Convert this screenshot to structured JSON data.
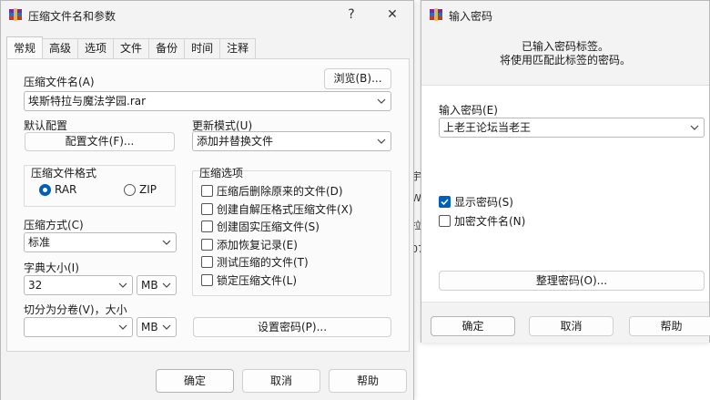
{
  "main_dialog": {
    "title": "压缩文件名和参数",
    "help_glyph": "?",
    "close_glyph": "✕",
    "tabs": [
      "常规",
      "高级",
      "选项",
      "文件",
      "备份",
      "时间",
      "注释"
    ],
    "archive_name_label": "压缩文件名(A)",
    "browse_button": "浏览(B)...",
    "archive_name_value": "埃斯特拉与魔法学园.rar",
    "default_profile_label": "默认配置",
    "profiles_button": "配置文件(F)...",
    "update_mode_label": "更新模式(U)",
    "update_mode_value": "添加并替换文件",
    "format_group_label": "压缩文件格式",
    "format_rar": "RAR",
    "format_zip": "ZIP",
    "format_selected": "RAR",
    "options_group_label": "压缩选项",
    "options": [
      {
        "label": "压缩后删除原来的文件(D)",
        "checked": false
      },
      {
        "label": "创建自解压格式压缩文件(X)",
        "checked": false
      },
      {
        "label": "创建固实压缩文件(S)",
        "checked": false
      },
      {
        "label": "添加恢复记录(E)",
        "checked": false
      },
      {
        "label": "测试压缩的文件(T)",
        "checked": false
      },
      {
        "label": "锁定压缩文件(L)",
        "checked": false
      }
    ],
    "method_label": "压缩方式(C)",
    "method_value": "标准",
    "dict_label": "字典大小(I)",
    "dict_value": "32",
    "dict_unit": "MB",
    "split_label": "切分为分卷(V)，大小",
    "split_value": "",
    "split_unit": "MB",
    "set_password_button": "设置密码(P)...",
    "ok_button": "确定",
    "cancel_button": "取消",
    "help_button": "帮助"
  },
  "password_dialog": {
    "title": "输入密码",
    "info_line1": "已输入密码标签。",
    "info_line2": "将使用匹配此标签的密码。",
    "password_label": "输入密码(E)",
    "password_value": "上老王论坛当老王",
    "show_password_label": "显示密码(S)",
    "show_password_checked": true,
    "encrypt_names_label": "加密文件名(N)",
    "encrypt_names_checked": false,
    "organize_button": "整理密码(O)...",
    "ok_button": "确定",
    "cancel_button": "取消",
    "help_button": "帮助"
  },
  "background_window": {
    "fragments": [
      "宇",
      "W",
      "拉",
      "07"
    ]
  },
  "colors": {
    "accent": "#005fb8",
    "dialog_bg": "#f3f3f3",
    "panel_bg": "#fbfbfb"
  }
}
